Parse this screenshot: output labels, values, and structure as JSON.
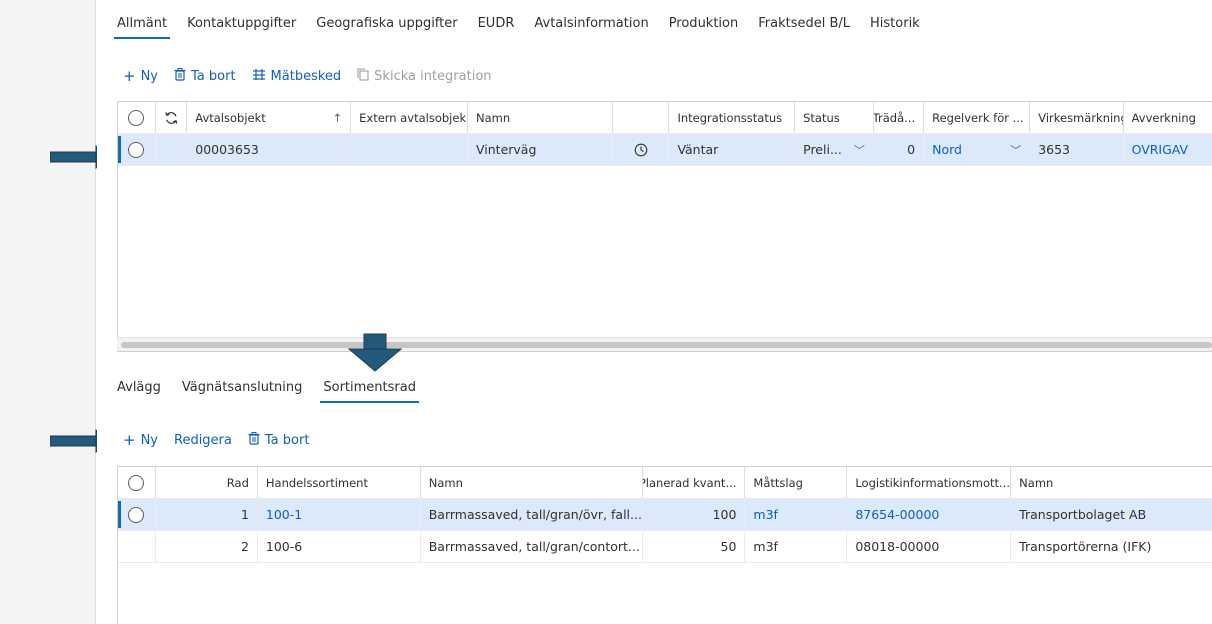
{
  "top_tabs": [
    "Allmänt",
    "Kontaktuppgifter",
    "Geografiska uppgifter",
    "EUDR",
    "Avtalsinformation",
    "Produktion",
    "Fraktsedel B/L",
    "Historik"
  ],
  "top_toolbar": {
    "new_label": "Ny",
    "delete_label": "Ta bort",
    "measure_label": "Mätbesked",
    "send_label": "Skicka integration"
  },
  "top_grid": {
    "headers": {
      "avtalsobjekt": "Avtalsobjekt",
      "extern": "Extern avtalsobjek...",
      "namn": "Namn",
      "integrationsstatus": "Integrationsstatus",
      "status": "Status",
      "trada": "Trädå...",
      "regelverk": "Regelverk för ...",
      "virkesmarkning": "Virkesmärkning",
      "avverkning": "Avverkning"
    },
    "rows": [
      {
        "avtalsobjekt": "00003653",
        "extern": "",
        "namn": "Vinterväg",
        "integrationsstatus": "Väntar",
        "status": "Preli...",
        "trada": "0",
        "regelverk": "Nord",
        "virkesmarkning": "3653",
        "avverkning": "OVRIGAV"
      }
    ]
  },
  "sub_tabs": [
    "Avlägg",
    "Vägnätsanslutning",
    "Sortimentsrad"
  ],
  "sub_toolbar": {
    "new_label": "Ny",
    "edit_label": "Redigera",
    "delete_label": "Ta bort"
  },
  "bottom_grid": {
    "headers": {
      "rad": "Rad",
      "handelssortiment": "Handelssortiment",
      "namn": "Namn",
      "planerad": "Planerad kvant...",
      "mattslag": "Måttslag",
      "logistik": "Logistikinformationsmott...",
      "namn2": "Namn"
    },
    "rows": [
      {
        "rad": "1",
        "handelssortiment": "100-1",
        "namn": "Barrmassaved, tall/gran/övr, fall...",
        "planerad": "100",
        "mattslag": "m3f",
        "logistik": "87654-00000",
        "namn2": "Transportbolaget AB"
      },
      {
        "rad": "2",
        "handelssortiment": "100-6",
        "namn": "Barrmassaved, tall/gran/contort...",
        "planerad": "50",
        "mattslag": "m3f",
        "logistik": "08018-00000",
        "namn2": "Transportörerna (IFK)"
      }
    ]
  },
  "colors": {
    "accent": "#0f6cbd",
    "link": "#0f5fbd",
    "selected_row": "#dbe9fb",
    "arrow": "#24597a"
  },
  "icons": {
    "new": "plus-icon",
    "delete": "trash-icon",
    "measure": "measure-icon",
    "send": "copy-icon",
    "refresh": "refresh-icon",
    "clock": "clock-icon",
    "sort": "sort-arrow-icon"
  }
}
